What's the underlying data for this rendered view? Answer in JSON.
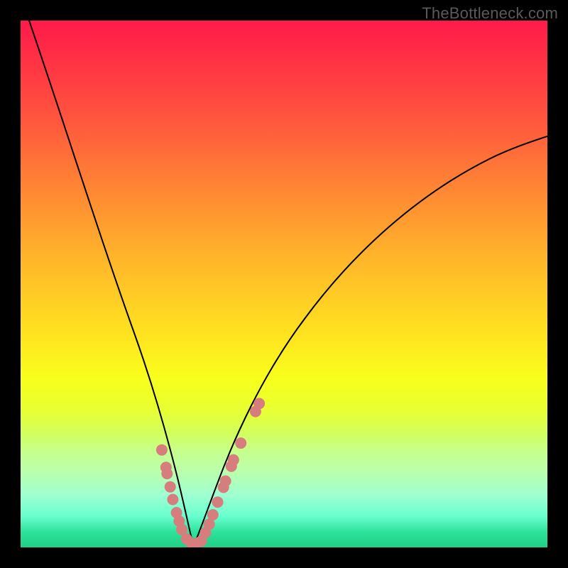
{
  "watermark": "TheBottleneck.com",
  "chart_data": {
    "type": "line",
    "title": "",
    "xlabel": "",
    "ylabel": "",
    "ylim": [
      0,
      100
    ],
    "xlim": [
      0,
      100
    ],
    "legend": null,
    "grid": false,
    "background_gradient": [
      "#ff1a4b",
      "#ffe41f",
      "#1fcf84"
    ],
    "series": [
      {
        "name": "left-branch",
        "x": [
          2,
          5,
          8,
          11,
          14,
          17,
          20,
          22,
          24,
          26,
          27,
          28,
          29,
          30,
          31,
          32
        ],
        "y": [
          100,
          87,
          75,
          64,
          54,
          45,
          36,
          29,
          23,
          17,
          13,
          10,
          7,
          4,
          2,
          0
        ]
      },
      {
        "name": "right-branch",
        "x": [
          32,
          34,
          36,
          38,
          41,
          44,
          48,
          54,
          60,
          67,
          75,
          83,
          91,
          100
        ],
        "y": [
          0,
          3,
          7,
          12,
          18,
          24,
          31,
          40,
          48,
          55,
          62,
          68,
          73,
          77
        ]
      }
    ],
    "markers": {
      "name": "bead-dots",
      "color": "#d67d7d",
      "radius_px": 8,
      "points_xy": [
        [
          26.8,
          18.5
        ],
        [
          27.6,
          15.2
        ],
        [
          27.8,
          14.0
        ],
        [
          28.4,
          11.5
        ],
        [
          28.9,
          9.1
        ],
        [
          29.6,
          6.6
        ],
        [
          30.1,
          5.0
        ],
        [
          30.6,
          3.4
        ],
        [
          31.5,
          1.6
        ],
        [
          32.4,
          0.8
        ],
        [
          33.4,
          0.8
        ],
        [
          34.3,
          1.2
        ],
        [
          35.1,
          2.8
        ],
        [
          35.8,
          4.4
        ],
        [
          36.5,
          6.2
        ],
        [
          37.4,
          8.6
        ],
        [
          38.5,
          11.4
        ],
        [
          38.9,
          12.6
        ],
        [
          40.0,
          15.4
        ],
        [
          40.4,
          16.6
        ],
        [
          41.8,
          19.8
        ],
        [
          44.6,
          25.8
        ],
        [
          45.3,
          27.3
        ]
      ]
    }
  },
  "colors": {
    "frame": "#000000",
    "curve": "#000000",
    "dot": "#d67d7d"
  }
}
